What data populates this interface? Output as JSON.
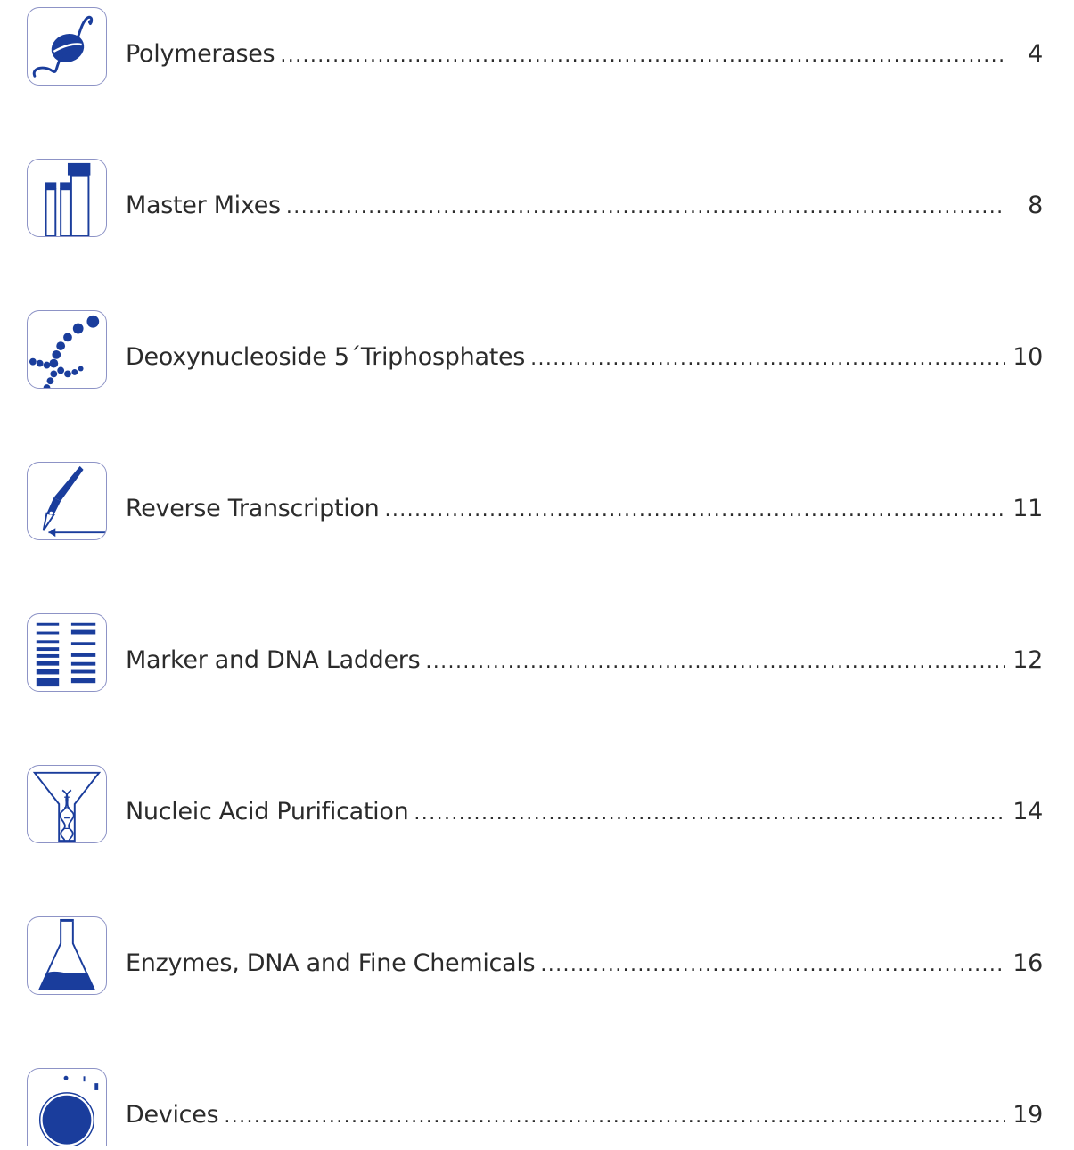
{
  "toc": {
    "entries": [
      {
        "title": "Polymerases",
        "page": "4",
        "icon": "polymerase-icon"
      },
      {
        "title": "Master Mixes",
        "page": "8",
        "icon": "master-mix-tubes-icon"
      },
      {
        "title": "Deoxynucleoside 5´Triphosphates",
        "page": "10",
        "icon": "nucleotide-chain-icon"
      },
      {
        "title": "Reverse Transcription",
        "page": "11",
        "icon": "fountain-pen-icon"
      },
      {
        "title": "Marker and DNA Ladders",
        "page": "12",
        "icon": "dna-ladder-gel-icon"
      },
      {
        "title": "Nucleic Acid Purification",
        "page": "14",
        "icon": "funnel-dna-icon"
      },
      {
        "title": "Enzymes, DNA and Fine Chemicals",
        "page": "16",
        "icon": "erlenmeyer-flask-icon"
      },
      {
        "title": "Devices",
        "page": "19",
        "icon": "device-dial-icon"
      }
    ]
  },
  "colors": {
    "accent": "#1a3d9c",
    "border": "#8d93c6",
    "text": "#2b2b2b"
  }
}
